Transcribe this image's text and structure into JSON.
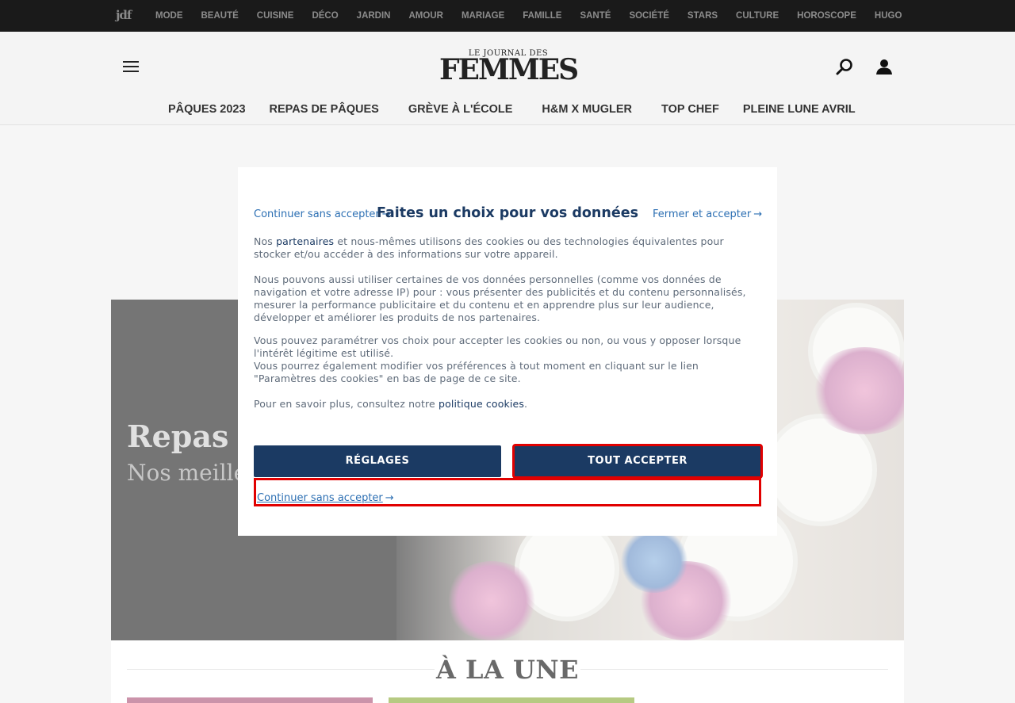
{
  "topbar": {
    "logo": "jdf",
    "nav": [
      "MODE",
      "BEAUTÉ",
      "CUISINE",
      "DÉCO",
      "JARDIN",
      "AMOUR",
      "MARIAGE",
      "FAMILLE",
      "SANTÉ",
      "SOCIÉTÉ",
      "STARS",
      "CULTURE",
      "HOROSCOPE",
      "HUGO"
    ]
  },
  "header": {
    "brand_small": "LE JOURNAL DES",
    "brand_big": "FEMMES",
    "menu_icon": "hamburger-icon",
    "search_icon": "search-icon",
    "user_icon": "user-icon",
    "trending": [
      "PÂQUES 2023",
      "REPAS DE PÂQUES",
      "GRÈVE À L'ÉCOLE",
      "H&M X MUGLER",
      "TOP CHEF",
      "PLEINE LUNE AVRIL"
    ]
  },
  "hero": {
    "title": "Repas d",
    "subtitle": "Nos meille votre menu"
  },
  "une": {
    "title": "À LA UNE"
  },
  "consent": {
    "continue_top": "Continuer sans accepter",
    "arrow": "→",
    "heading": "Faites un choix pour vos données",
    "close_accept": "Fermer et accepter",
    "p1_before": "Nos ",
    "p1_link": "partenaires",
    "p1_after": " et nous-mêmes utilisons des cookies ou des technologies équivalentes pour stocker et/ou accéder à des informations sur votre appareil.",
    "p2": "Nous pouvons aussi utiliser certaines de vos données personnelles (comme vos données de navigation et votre adresse IP) pour : vous présenter des publicités et du contenu personnalisés, mesurer la performance publicitaire et du contenu et en apprendre plus sur leur audience, développer et améliorer les produits de nos partenaires.",
    "p3": "Vous pouvez paramétrer vos choix pour accepter les cookies ou non, ou vous y opposer lorsque l'intérêt légitime est utilisé.",
    "p4": "Vous pourrez également modifier vos préférences à tout moment en cliquant sur le lien \"Paramètres des cookies\" en bas de page de ce site.",
    "p5_before": "Pour en savoir plus, consultez notre ",
    "p5_link": "politique cookies",
    "p5_after": ".",
    "btn_settings": "RÉGLAGES",
    "btn_accept": "TOUT ACCEPTER",
    "continue_bottom": "Continuer sans accepter"
  },
  "colors": {
    "accent": "#1b3a63",
    "link": "#2c6fb3",
    "highlight": "#e10000"
  }
}
